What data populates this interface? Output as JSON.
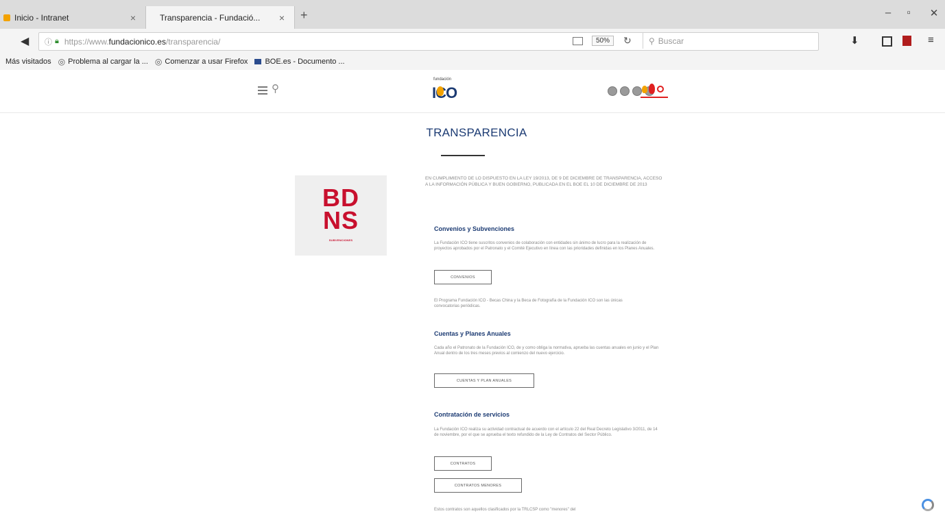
{
  "browser": {
    "tabs": [
      {
        "title": "Inicio - Intranet"
      },
      {
        "title": "Transparencia - Fundació..."
      }
    ],
    "url": {
      "prefix": "https://www.",
      "domain": "fundacionico.es",
      "path": "/transparencia/"
    },
    "zoom": "50%",
    "search_placeholder": "Buscar",
    "bookmarks": [
      {
        "label": "Más visitados"
      },
      {
        "label": "Problema al cargar la ..."
      },
      {
        "label": "Comenzar a usar Firefox"
      },
      {
        "label": "BOE.es - Documento ..."
      }
    ],
    "colors": {
      "tab_bar": "#dcdcdc",
      "toolbar": "#f4f4f4"
    }
  },
  "site": {
    "logo_text": "ICO",
    "logo_small": "fundación",
    "colors": {
      "brand_blue": "#1c3b73",
      "accent_orange": "#f3a200",
      "bdns_red": "#c8102e"
    }
  },
  "page": {
    "title": "TRANSPARENCIA",
    "bdns": {
      "line1": "BD",
      "line2": "NS",
      "caption": "SUBVENCIONES"
    },
    "intro": "EN CUMPLIMIENTO DE LO DISPUESTO EN LA LEY 19/2013, DE 9 DE DICIEMBRE DE TRANSPARENCIA, ACCESO A LA INFORMACIÓN PÚBLICA Y BUEN GOBIERNO, PUBLICADA EN EL BOE EL 10 DE DICIEMBRE DE 2013",
    "sections": [
      {
        "heading": "Convenios y Subvenciones",
        "text": "La Fundación ICO tiene suscritos convenios de colaboración con entidades sin ánimo de lucro para la realización de proyectos aprobados por el Patronato y el Comité Ejecutivo en línea con las prioridades definidas en los Planes Anuales.",
        "button": "CONVENIOS",
        "note": "El Programa Fundación ICO - Becas China y la Beca de Fotografía de la Fundación ICO son las únicas convocatorias periódicas."
      },
      {
        "heading": "Cuentas y Planes Anuales",
        "text": "Cada año el Patronato de la Fundación ICO, de y como obliga la normativa, aprueba las cuentas anuales en junio y el Plan Anual dentro de los tres meses previos al comienzo del nuevo ejercicio.",
        "button": "CUENTAS Y PLAN ANUALES"
      },
      {
        "heading": "Contratación de servicios",
        "text": "La Fundación ICO realiza su actividad contractual de acuerdo con el artículo 22 del Real Decreto Legislativo 3/2011, de 14 de noviembre, por el que se aprueba el texto refundido de la Ley de Contratos del Sector Público.",
        "button": "CONTRATOS",
        "button2": "CONTRATOS MENORES",
        "note": "Estos contratos son aquellos clasificados por la TRLCSP como \"menores\" del"
      }
    ]
  }
}
